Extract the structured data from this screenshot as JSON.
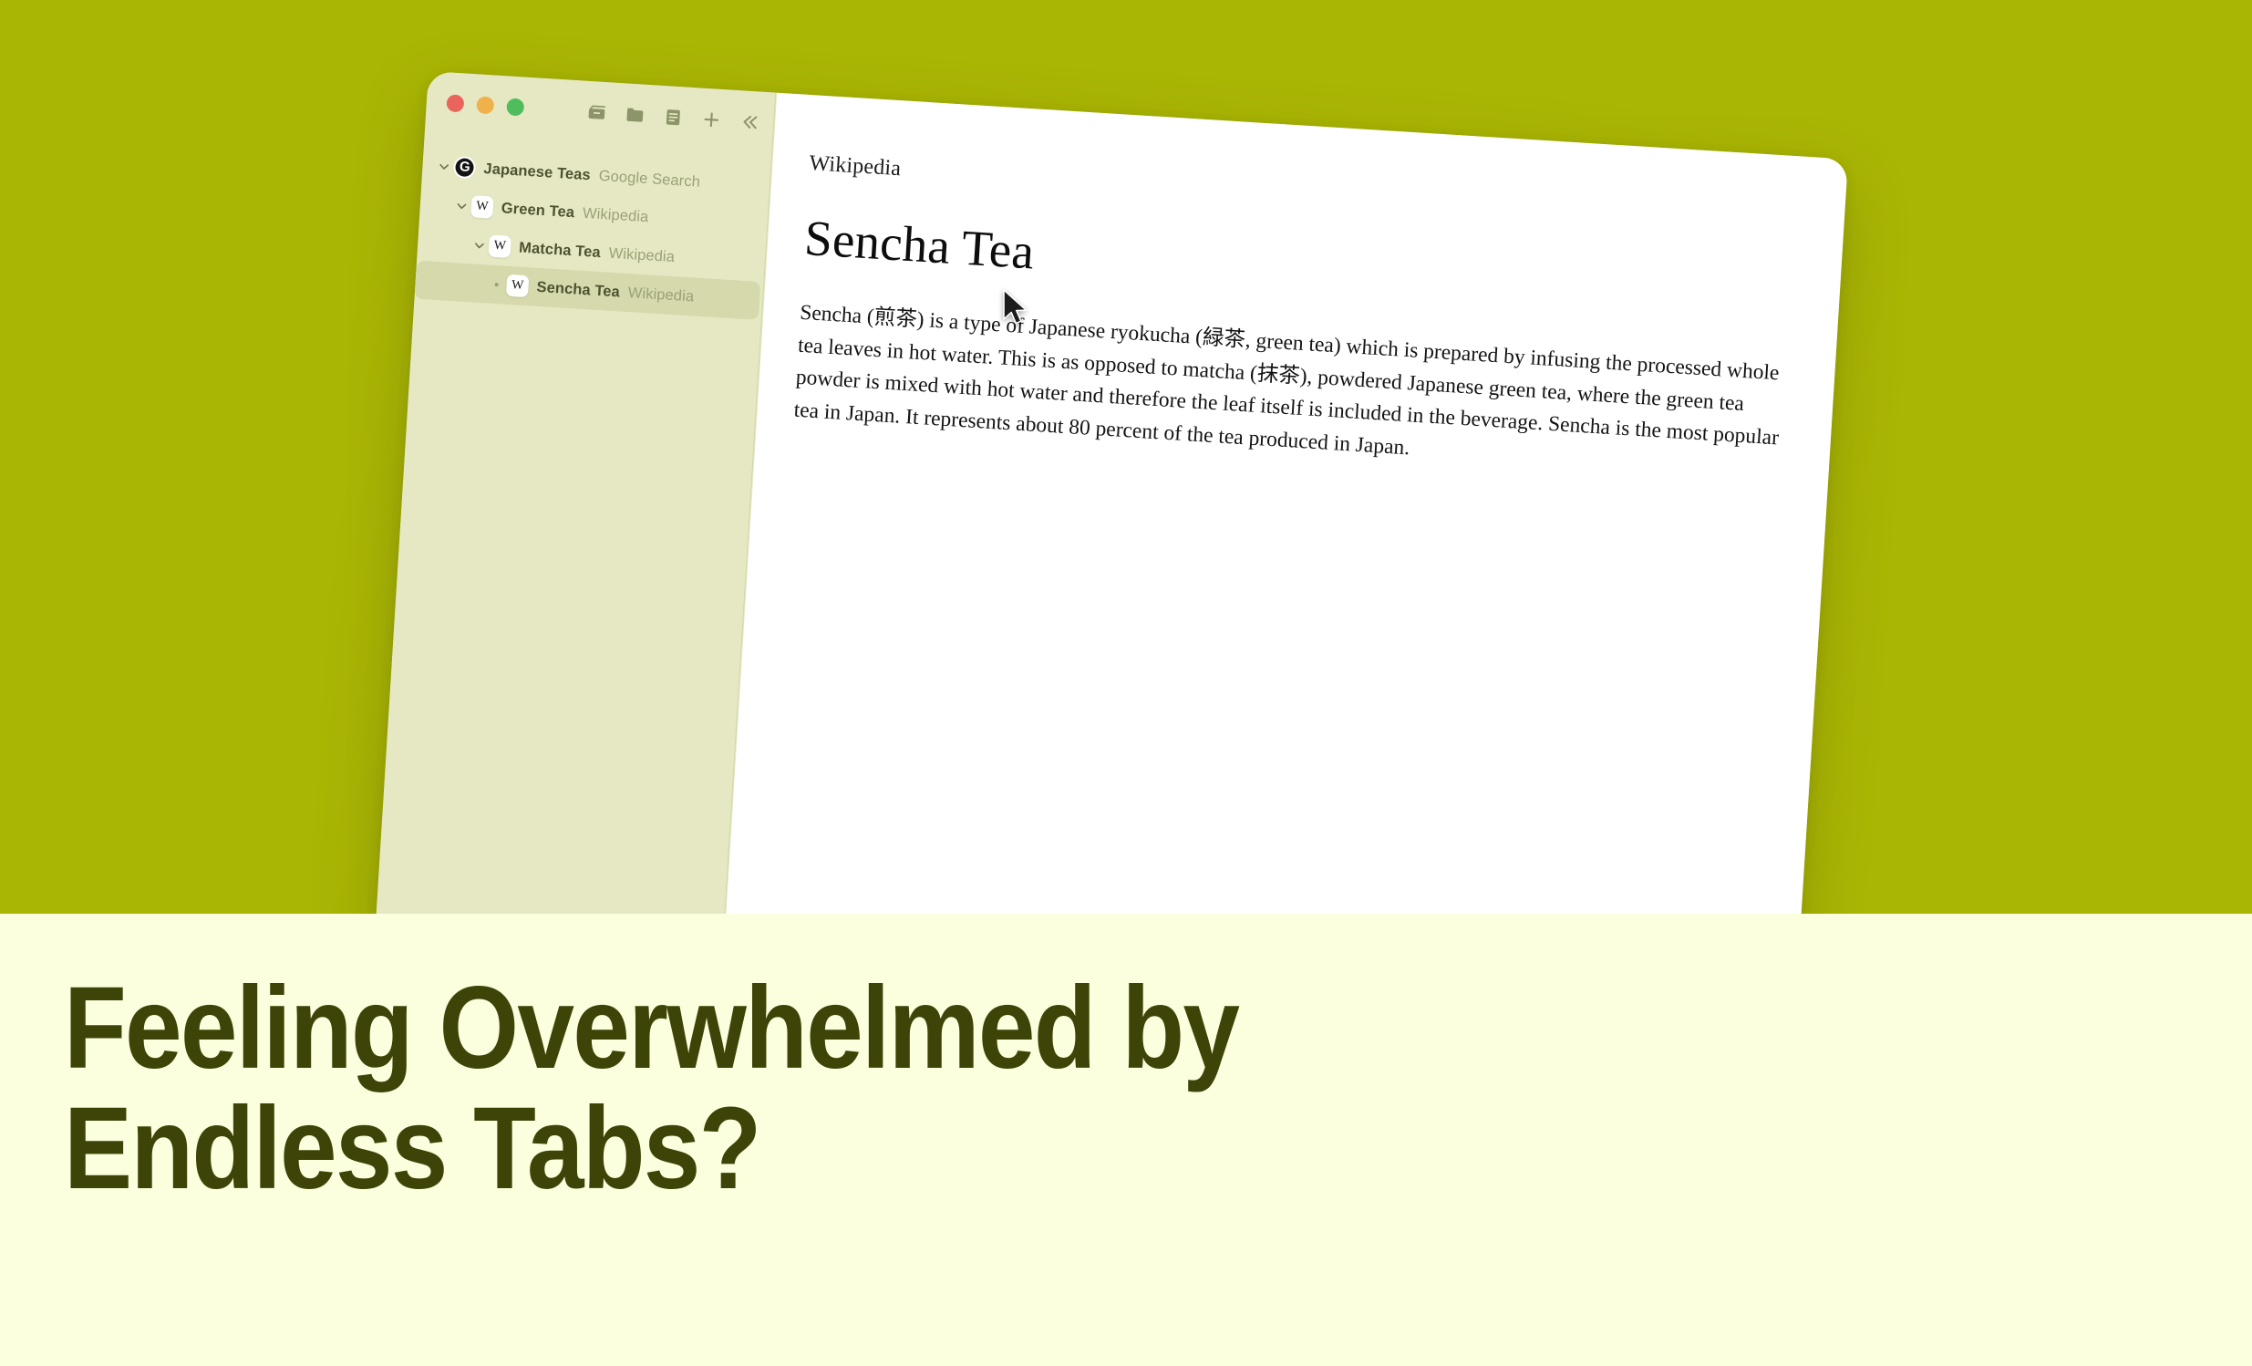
{
  "hero": {
    "background_color": "#aab604"
  },
  "window": {
    "traffic_lights": [
      {
        "name": "close",
        "color": "#e9645c"
      },
      {
        "name": "minimize",
        "color": "#efb24a"
      },
      {
        "name": "zoom",
        "color": "#4fbd5e"
      }
    ],
    "toolbar": [
      {
        "icon": "archive-box-icon",
        "label": "Archive"
      },
      {
        "icon": "folder-icon",
        "label": "New Folder"
      },
      {
        "icon": "note-icon",
        "label": "New Note"
      },
      {
        "icon": "plus-icon",
        "label": "New Tab"
      },
      {
        "icon": "collapse-sidebar-icon",
        "label": "Collapse Sidebar"
      }
    ],
    "sidebar": {
      "background_color": "#e6e8c3",
      "selected_color": "#d6d9ac",
      "tabs": [
        {
          "title": "Japanese Teas",
          "source": "Google Search",
          "favicon": "google-icon",
          "favicon_glyph": "G",
          "depth": 0,
          "expanded": true,
          "has_children": true,
          "selected": false
        },
        {
          "title": "Green Tea",
          "source": "Wikipedia",
          "favicon": "wikipedia-icon",
          "favicon_glyph": "W",
          "depth": 1,
          "expanded": true,
          "has_children": true,
          "selected": false
        },
        {
          "title": "Matcha Tea",
          "source": "Wikipedia",
          "favicon": "wikipedia-icon",
          "favicon_glyph": "W",
          "depth": 2,
          "expanded": true,
          "has_children": true,
          "selected": false
        },
        {
          "title": "Sencha Tea",
          "source": "Wikipedia",
          "favicon": "wikipedia-icon",
          "favicon_glyph": "W",
          "depth": 3,
          "expanded": false,
          "has_children": false,
          "selected": true
        }
      ]
    },
    "content": {
      "source": "Wikipedia",
      "title": "Sencha Tea",
      "body": "Sencha (煎茶) is a type of Japanese ryokucha (緑茶, green tea) which is prepared by infusing the processed whole tea leaves in hot water. This is as opposed to matcha (抹茶), powdered Japanese green tea, where the green tea powder is mixed with hot water and therefore the leaf itself is included in the beverage. Sencha is the most popular tea in Japan. It represents about 80 percent of the tea produced in Japan."
    }
  },
  "headline": {
    "line1": "Feeling Overwhelmed by",
    "line2": "Endless Tabs?",
    "color": "#3e4407",
    "background_color": "#fbffdd"
  }
}
